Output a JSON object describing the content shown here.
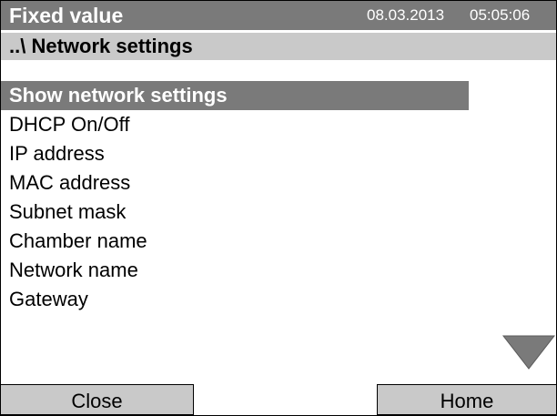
{
  "header": {
    "title": "Fixed value",
    "date": "08.03.2013",
    "time": "05:05:06"
  },
  "breadcrumb": "..\\ Network settings",
  "menu": {
    "items": [
      {
        "label": "Show network settings",
        "selected": true
      },
      {
        "label": "DHCP On/Off"
      },
      {
        "label": "IP address"
      },
      {
        "label": "MAC address"
      },
      {
        "label": "Subnet mask"
      },
      {
        "label": "Chamber name"
      },
      {
        "label": "Network name"
      },
      {
        "label": "Gateway"
      }
    ]
  },
  "scroll_icon": "triangle-down-icon",
  "buttons": {
    "close": "Close",
    "home": "Home"
  },
  "colors": {
    "header_bg": "#7a7a7a",
    "breadcrumb_bg": "#c9c9c9",
    "selected_bg": "#7a7a7a",
    "button_bg": "#c9c9c9"
  }
}
